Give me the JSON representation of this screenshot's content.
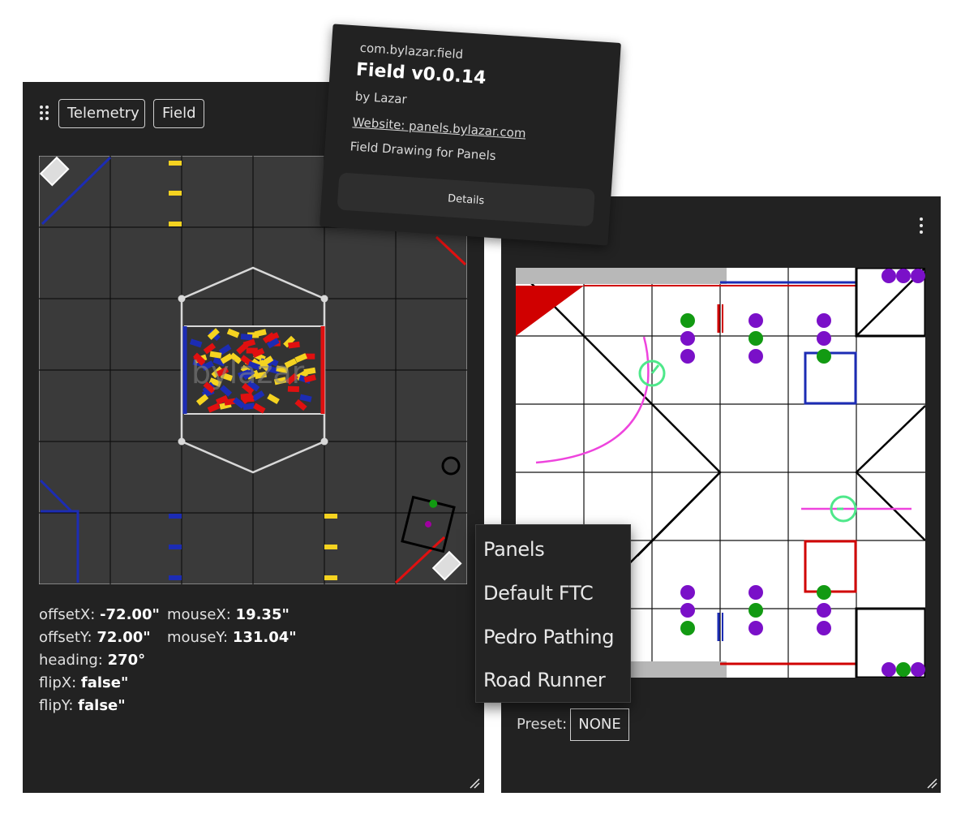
{
  "left_panel": {
    "tabs": [
      {
        "label": "Telemetry"
      },
      {
        "label": "Field"
      }
    ],
    "readouts": {
      "offsetX": {
        "label": "offsetX:",
        "value": "-72.00\""
      },
      "offsetY": {
        "label": "offsetY:",
        "value": "72.00\""
      },
      "heading": {
        "label": "heading:",
        "value": "270°"
      },
      "flipX": {
        "label": "flipX:",
        "value": "false\""
      },
      "flipY": {
        "label": "flipY:",
        "value": "false\""
      },
      "mouseX": {
        "label": "mouseX:",
        "value": "19.35\""
      },
      "mouseY": {
        "label": "mouseY:",
        "value": "131.04\""
      }
    },
    "field_watermark": "bylazar"
  },
  "plugin_popover": {
    "id": "com.bylazar.field",
    "title": "Field v0.0.14",
    "author": "by Lazar",
    "website": "Website: panels.bylazar.com",
    "description": "Field Drawing for Panels",
    "details_label": "Details"
  },
  "preset_menu": {
    "items": [
      {
        "label": "Panels"
      },
      {
        "label": "Default FTC"
      },
      {
        "label": "Pedro Pathing"
      },
      {
        "label": "Road Runner"
      }
    ]
  },
  "right_panel": {
    "preset_label": "Preset:",
    "preset_value": "NONE"
  },
  "colors": {
    "panel_bg": "#222222",
    "field_dark": "#3a3a3a",
    "field_light": "#ffffff",
    "alliance_red": "#e01010",
    "alliance_blue": "#1c2cb4",
    "sample_yellow": "#f5d320",
    "robot_green": "#4ee88a",
    "path_magenta": "#ee44dd",
    "artifact_purple": "#7a10c8",
    "artifact_green": "#129a12"
  },
  "icons": {
    "drag": "drag-dots-icon",
    "menu": "kebab-menu-icon",
    "resize": "resize-grip-icon"
  }
}
